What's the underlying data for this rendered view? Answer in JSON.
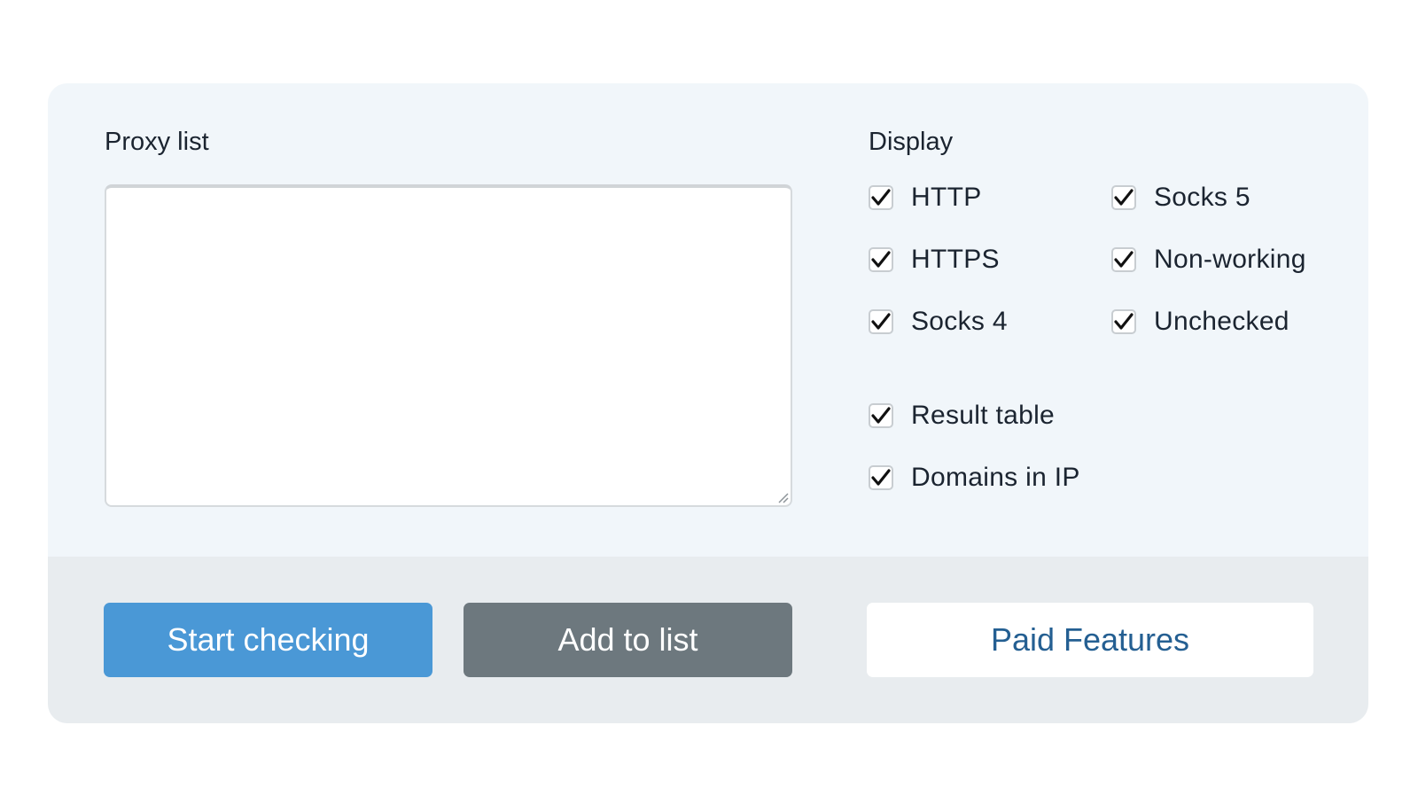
{
  "proxy_list": {
    "label": "Proxy list",
    "value": "",
    "placeholder": ""
  },
  "display": {
    "label": "Display",
    "options": [
      {
        "label": "HTTP",
        "checked": true
      },
      {
        "label": "HTTPS",
        "checked": true
      },
      {
        "label": "Socks 4",
        "checked": true
      },
      {
        "label": "Socks 5",
        "checked": true
      },
      {
        "label": "Non-working",
        "checked": true
      },
      {
        "label": "Unchecked",
        "checked": true
      },
      {
        "label": "Result table",
        "checked": true
      },
      {
        "label": "Domains in IP",
        "checked": true
      }
    ]
  },
  "actions": {
    "start_label": "Start checking",
    "add_label": "Add to list",
    "paid_label": "Paid Features"
  },
  "colors": {
    "card_bg": "#f1f6fa",
    "footer_bg": "#e8ecef",
    "start_button": "#4a98d6",
    "add_button": "#6d787e",
    "paid_text": "#245f92"
  },
  "icons": {
    "checkbox": "checkmark-icon",
    "resize": "resize-grip-icon"
  }
}
